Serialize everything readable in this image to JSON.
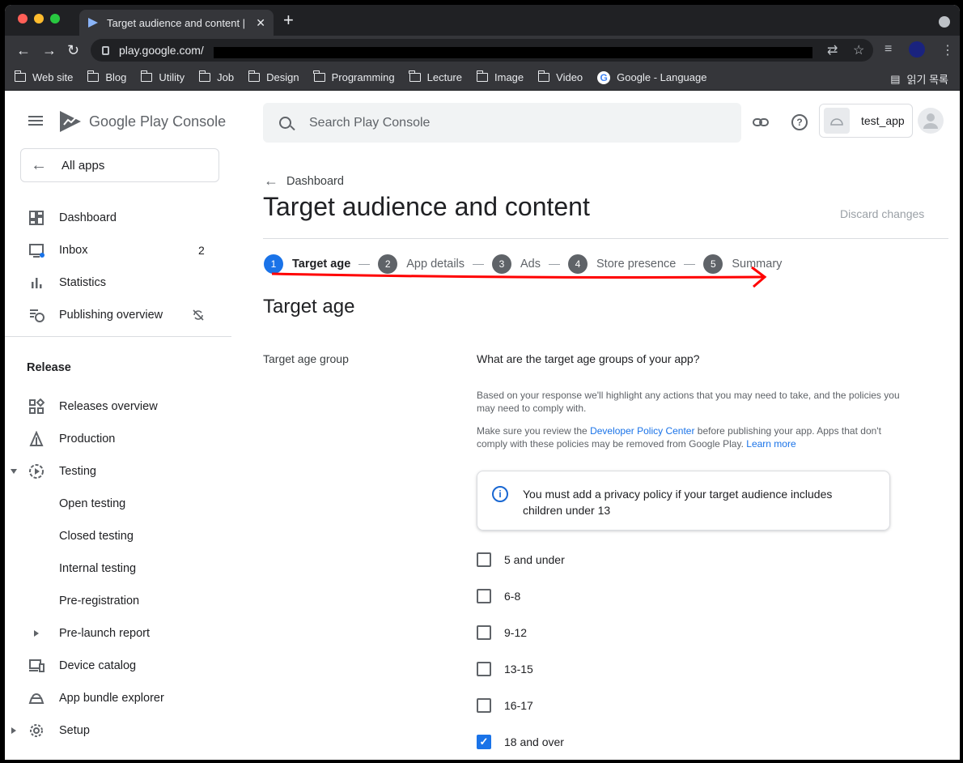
{
  "browser": {
    "tab_title": "Target audience and content | ",
    "url": "play.google.com/",
    "bookmarks": [
      "Web site",
      "Blog",
      "Utility",
      "Job",
      "Design",
      "Programming",
      "Lecture",
      "Image",
      "Video"
    ],
    "bookmark_google": "Google - Language",
    "reading_list": "읽기 목록"
  },
  "header": {
    "brand_google_play": "Google Play",
    "brand_console": "Console",
    "search_placeholder": "Search Play Console",
    "app_name": "test_app"
  },
  "sidebar": {
    "all_apps": "All apps",
    "items": [
      {
        "label": "Dashboard",
        "icon": "dashboard-icon"
      },
      {
        "label": "Inbox",
        "icon": "inbox-icon",
        "badge": "2"
      },
      {
        "label": "Statistics",
        "icon": "bar-chart-icon"
      },
      {
        "label": "Publishing overview",
        "icon": "schedule-icon"
      }
    ],
    "release_section": "Release",
    "release_items": [
      {
        "label": "Releases overview",
        "icon": "releases-icon"
      },
      {
        "label": "Production",
        "icon": "production-icon"
      },
      {
        "label": "Testing",
        "icon": "testing-icon"
      },
      {
        "label": "Open testing"
      },
      {
        "label": "Closed testing"
      },
      {
        "label": "Internal testing"
      },
      {
        "label": "Pre-registration"
      },
      {
        "label": "Pre-launch report"
      },
      {
        "label": "Device catalog",
        "icon": "devices-icon"
      },
      {
        "label": "App bundle explorer",
        "icon": "android-icon"
      },
      {
        "label": "Setup",
        "icon": "gear-icon"
      }
    ]
  },
  "page": {
    "back_label": "Dashboard",
    "title": "Target audience and content",
    "discard": "Discard changes",
    "steps": [
      {
        "num": "1",
        "label": "Target age"
      },
      {
        "num": "2",
        "label": "App details"
      },
      {
        "num": "3",
        "label": "Ads"
      },
      {
        "num": "4",
        "label": "Store presence"
      },
      {
        "num": "5",
        "label": "Summary"
      }
    ],
    "section_title": "Target age",
    "field_label": "Target age group",
    "question": "What are the target age groups of your app?",
    "help1": "Based on your response we'll highlight any actions that you may need to take, and the policies you may need to comply with.",
    "help2_a": "Make sure you review the ",
    "help2_link": "Developer Policy Center",
    "help2_b": " before publishing your app. Apps that don't comply with these policies may be removed from Google Play. ",
    "help2_link2": "Learn more",
    "callout": "You must add a privacy policy if your target audience includes children under 13",
    "age_groups": [
      {
        "label": "5 and under",
        "checked": false
      },
      {
        "label": "6-8",
        "checked": false
      },
      {
        "label": "9-12",
        "checked": false
      },
      {
        "label": "13-15",
        "checked": false
      },
      {
        "label": "16-17",
        "checked": false
      },
      {
        "label": "18 and over",
        "checked": true
      }
    ]
  },
  "colors": {
    "accent": "#1a73e8",
    "annotation": "#ff0000"
  }
}
